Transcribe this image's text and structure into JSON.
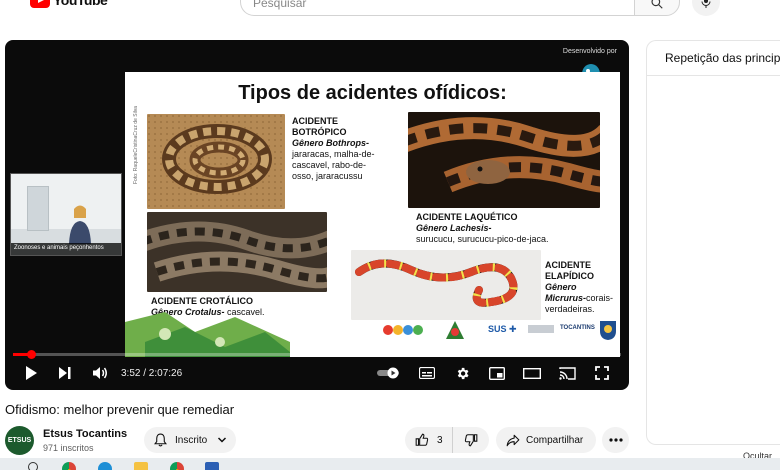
{
  "header": {
    "logo_text": "YouTube",
    "search_placeholder": "Pesquisar"
  },
  "player": {
    "dev_label": "Desenvolvido por",
    "webcam_caption": "Zoonoses e animais peçonhentos",
    "current_time": "3:52",
    "duration": "2:07:26",
    "time_display": "3:52 / 2:07:26",
    "progress_fraction": 0.03,
    "slide": {
      "title": "Tipos de acidentes ofídicos:",
      "photo_credit": "Foto: RaqueleCristinaCruz de Silva",
      "botropico": {
        "line1": "ACIDENTE",
        "line2": "BOTRÓPICO",
        "genus": "Gênero Bothrops-",
        "desc1": "jararacas, malha-de-",
        "desc2": "cascavel, rabo-de-",
        "desc3": "osso, jararacussu"
      },
      "laquetico": {
        "line1": "ACIDENTE LAQUÉTICO",
        "genus": "Gênero Lachesis-",
        "desc": "surucucu, surucucu-pico-de-jaca."
      },
      "crotalico": {
        "line1": "ACIDENTE CROTÁLICO",
        "genus": "Gênero Crotalus-",
        "desc": " cascavel."
      },
      "elapidico": {
        "line1": "ACIDENTE",
        "line2": "ELAPÍDICO",
        "genus1": "Gênero",
        "genus2": "Micrurus-",
        "desc1": "corais-",
        "desc2": "verdadeiras."
      },
      "logo_sus": "SUS",
      "logo_tocantins": "TOCANTINS"
    }
  },
  "video": {
    "title": "Ofidismo: melhor prevenir que remediar",
    "channel_avatar_text": "ETSUS",
    "channel_name": "Etsus Tocantins",
    "subscribers": "971 inscritos",
    "subscribe_label": "Inscrito",
    "like_count": "3",
    "share_label": "Compartilhar"
  },
  "sidebar": {
    "heading": "Repetição das principais",
    "hide_label": "Ocultar"
  },
  "colors": {
    "brand_red": "#ff0000",
    "player_bg": "#0b0b0b",
    "pill_bg": "#f2f2f2"
  }
}
